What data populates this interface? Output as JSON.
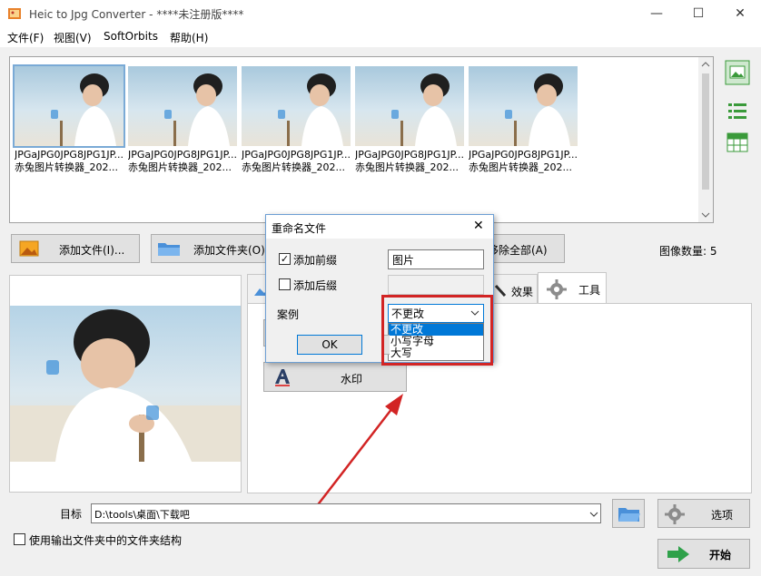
{
  "window": {
    "title": "Heic to Jpg Converter  - ****未注册版****",
    "minimize_glyph": "—",
    "maximize_glyph": "☐",
    "close_glyph": "✕"
  },
  "menu": [
    "文件(F)",
    "视图(V)",
    "SoftOrbits",
    "帮助(H)"
  ],
  "thumbnails": [
    {
      "line1": "JPGaJPG0JPG8JPG1JP...",
      "line2": "赤兔图片转换器_202..."
    },
    {
      "line1": "JPGaJPG0JPG8JPG1JP...",
      "line2": "赤兔图片转换器_202..."
    },
    {
      "line1": "JPGaJPG0JPG8JPG1JP...",
      "line2": "赤兔图片转换器_202..."
    },
    {
      "line1": "JPGaJPG0JPG8JPG1JP...",
      "line2": "赤兔图片转换器_202..."
    },
    {
      "line1": "JPGaJPG0JPG8JPG1JP...",
      "line2": "赤兔图片转换器_202..."
    }
  ],
  "buttons": {
    "add_file": "添加文件(I)...",
    "add_folder": "添加文件夹(O)...",
    "remove_all": "移除全部(A)",
    "watermark": "水印",
    "options": "选项",
    "start": "开始"
  },
  "image_count": "图像数量: 5",
  "tabs": {
    "effects": "效果",
    "tools": "工具"
  },
  "dialog": {
    "title": "重命名文件",
    "close_glyph": "✕",
    "add_prefix": "添加前缀",
    "add_prefix_checked": true,
    "prefix_value": "图片",
    "add_suffix": "添加后缀",
    "add_suffix_checked": false,
    "suffix_value": "",
    "case_label": "案例",
    "case_selected": "不更改",
    "case_options": [
      "不更改",
      "小写字母",
      "大写"
    ],
    "ok": "OK"
  },
  "target": {
    "label": "目标",
    "path": "D:\\tools\\桌面\\下载吧"
  },
  "use_folder_structure": "使用输出文件夹中的文件夹结构",
  "colors": {
    "accent": "#0078d7",
    "highlight_red": "#d22424",
    "selection": "#3399ff"
  }
}
